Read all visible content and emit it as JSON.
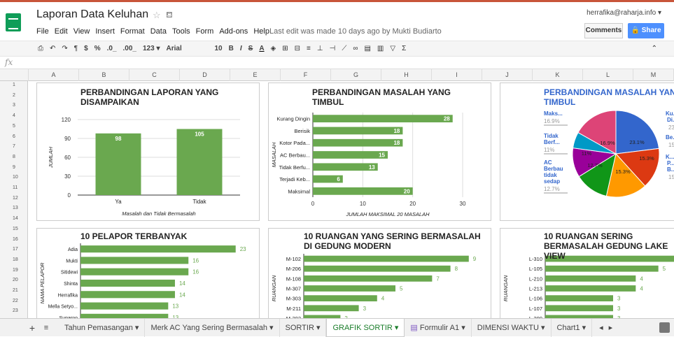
{
  "app": {
    "doc_title": "Laporan Data Keluhan",
    "user": "herrafika@raharja.info",
    "last_edit": "Last edit was made 10 days ago by Mukti Budiarto",
    "comments_label": "Comments",
    "share_label": "Share",
    "menu": [
      "File",
      "Edit",
      "View",
      "Insert",
      "Format",
      "Data",
      "Tools",
      "Form",
      "Add-ons",
      "Help"
    ]
  },
  "toolbar": {
    "currency": "$",
    "percent": "%",
    "decimal_less": ".0_",
    "decimal_more": ".00_",
    "number_format": "123",
    "font": "Arial",
    "font_size": "10"
  },
  "columns": [
    "A",
    "B",
    "C",
    "D",
    "E",
    "F",
    "G",
    "H",
    "I",
    "J",
    "K",
    "L",
    "M"
  ],
  "rows": [
    "1",
    "2",
    "3",
    "4",
    "5",
    "6",
    "7",
    "8",
    "9",
    "10",
    "11",
    "12",
    "13",
    "14",
    "15",
    "16",
    "17",
    "18",
    "19",
    "20",
    "21",
    "22",
    "23"
  ],
  "sheets": {
    "tabs": [
      "Tahun Pemasangan",
      "Merk AC Yang Sering Bermasalah",
      "SORTIR",
      "GRAFIK SORTIR",
      "Formulir A1",
      "DIMENSI WAKTU",
      "Chart1"
    ],
    "active": "GRAFIK SORTIR"
  },
  "chart_data": [
    {
      "type": "bar",
      "title": "PERBANDINGAN LAPORAN YANG DISAMPAIKAN",
      "categories": [
        "Ya",
        "Tidak"
      ],
      "values": [
        98,
        105
      ],
      "xlabel": "Masalah dan Tidak Bermasalah",
      "ylabel": "JUMLAH",
      "ylim": [
        0,
        120
      ],
      "yticks": [
        0,
        30,
        60,
        90,
        120
      ],
      "color": "#6aa84f"
    },
    {
      "type": "bar",
      "orientation": "horizontal",
      "title": "PERBANDINGAN MASALAH YANG TIMBUL",
      "categories": [
        "Kurang Dingin",
        "Berisik",
        "Kotor Pada...",
        "AC Berbau...",
        "Tidak Berfu...",
        "Terjadi Keb...",
        "Maksimal"
      ],
      "values": [
        28,
        18,
        18,
        15,
        13,
        6,
        20
      ],
      "xlabel": "JUMLAH MAKSIMAL 20 MASALAH",
      "ylabel": "MASALAH",
      "xlim": [
        0,
        30
      ],
      "xticks": [
        0,
        10,
        20,
        30
      ],
      "color": "#6aa84f"
    },
    {
      "type": "pie",
      "title": "PERBANDINGAN MASALAH YANG TIMBUL",
      "slices": [
        {
          "label": "Kurang Dingin",
          "legend_label": "Ku... Di...",
          "value": 23.1,
          "color": "#3366cc"
        },
        {
          "label": "Berisik",
          "legend_label": "Be...",
          "value": 15.3,
          "color": "#dc3912"
        },
        {
          "label": "Kotor Pada...",
          "legend_label": "K... P... B...",
          "value": 15.3,
          "color": "#ff9900"
        },
        {
          "label": "AC Berbau tidak sedap",
          "legend_label": "AC Berbau tidak sedap",
          "value": 12.7,
          "color": "#109618"
        },
        {
          "label": "Tidak Berf...",
          "legend_label": "Tidak Berf...",
          "value": 11,
          "color": "#990099"
        },
        {
          "label": "Terjadi Keb...",
          "value": 6.0,
          "color": "#0099c6"
        },
        {
          "label": "Maksimal",
          "legend_label": "Maks...",
          "value": 16.9,
          "color": "#dd4477"
        }
      ],
      "left_legend": [
        {
          "label": "Maks...",
          "pct": "16.9%"
        },
        {
          "label": "Tidak Berf...",
          "pct": "11%"
        },
        {
          "label": "AC Berbau tidak sedap",
          "pct": "12.7%"
        }
      ],
      "right_legend": [
        {
          "label": "Ku... Di...",
          "pct": "23"
        },
        {
          "label": "Be...",
          "pct": "15"
        },
        {
          "label": "K... P... B...",
          "pct": "15"
        }
      ],
      "slice_labels": [
        "23.1%",
        "15.3%",
        "15.3%",
        "12.7%",
        "11%",
        "16.9%"
      ]
    },
    {
      "type": "bar",
      "orientation": "horizontal",
      "title": "10 PELAPOR TERBANYAK",
      "categories": [
        "Adia",
        "Mukti",
        "Sitidewi",
        "Shinta",
        "Herrafika",
        "Mella Setyo...",
        "Suparno"
      ],
      "values": [
        23,
        16,
        16,
        14,
        14,
        13,
        13
      ],
      "ylabel": "NAMA PELAPOR",
      "xlim": [
        0,
        25
      ],
      "color": "#6aa84f"
    },
    {
      "type": "bar",
      "orientation": "horizontal",
      "title": "10 RUANGAN YANG SERING BERMASALAH DI GEDUNG MODERN",
      "categories": [
        "M-102",
        "M-206",
        "M-108",
        "M-307",
        "M-303",
        "M-211",
        "M-302"
      ],
      "values": [
        9,
        8,
        7,
        5,
        4,
        3,
        2
      ],
      "ylabel": "RUANGAN",
      "xlim": [
        0,
        10
      ],
      "color": "#6aa84f"
    },
    {
      "type": "bar",
      "orientation": "horizontal",
      "title": "10 RUANGAN SERING BERMASALAH GEDUNG LAKE VIEW",
      "categories": [
        "L-310",
        "L-105",
        "L-210",
        "L-213",
        "L-106",
        "L-107",
        "L-209"
      ],
      "values": [
        6,
        5,
        4,
        4,
        3,
        3,
        3
      ],
      "ylabel": "RUANGAN",
      "xlim": [
        0,
        6
      ],
      "color": "#6aa84f"
    }
  ]
}
